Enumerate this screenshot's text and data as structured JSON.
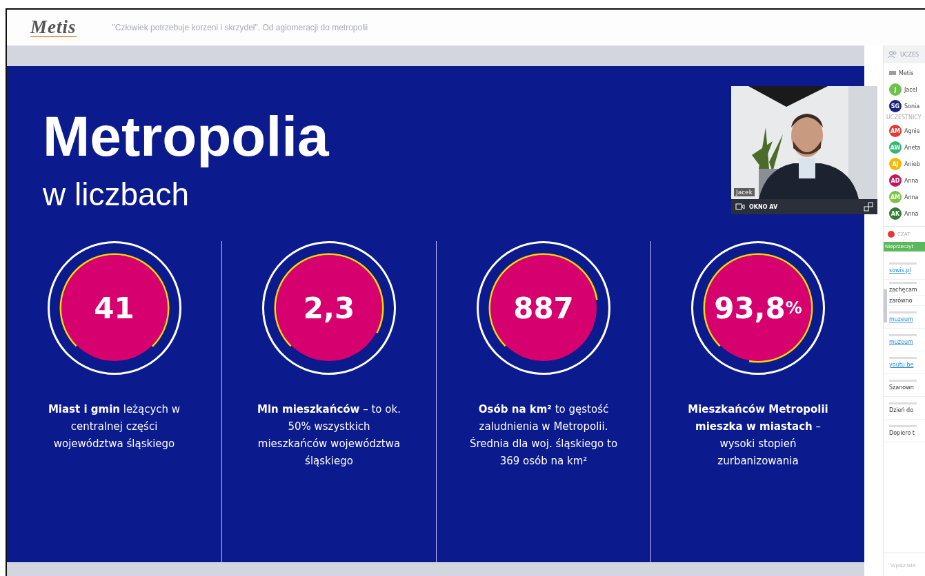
{
  "header": {
    "logo": "Metis",
    "title": "\"Człowiek potrzebuje korzeni i skrzydeł\". Od aglomeracji do metropolii"
  },
  "slide": {
    "title": "Metropolia",
    "subtitle": "w liczbach",
    "stats": [
      {
        "value": "41",
        "level": 0.75,
        "description": "**Miast i gmin** leżących w centralnej części województwa śląskiego"
      },
      {
        "value": "2,3",
        "level": 0.7,
        "description": "**Mln mieszkańców** – to ok. 50% wszystkich mieszkańców województwa śląskiego"
      },
      {
        "value": "887",
        "level": 0.6,
        "description": "**Osób na km²** to gęstość zaludnienia w Metropolii. Średnia dla woj. śląskiego to 369 osób na km²"
      },
      {
        "value": "93,8",
        "unit": "%",
        "level": 0.9,
        "description": "**Mieszkańców Metropolii mieszka w miastach** – wysoki stopień zurbanizowania"
      }
    ]
  },
  "video": {
    "kind": "picture",
    "speaker": "Jacek",
    "bar_label": "OKNO AV"
  },
  "sidebar": {
    "participants_header": "UCZES",
    "hosts": [
      {
        "kind": "tag",
        "name": "Metis",
        "color": "#9e9e9e"
      },
      {
        "kind": "avatar",
        "initials": "J",
        "name": "Jacel",
        "color": "#6cc24a"
      },
      {
        "kind": "avatar",
        "initials": "SG",
        "name": "Sonia",
        "color": "#1a237e"
      }
    ],
    "group_label": "UCZESTNICY",
    "participants": [
      {
        "initials": "AM",
        "name": "Agnie",
        "color": "#e53935"
      },
      {
        "initials": "AW",
        "name": "Aneta",
        "color": "#2eb872"
      },
      {
        "initials": "AJ",
        "name": "Anieb",
        "color": "#f5b800"
      },
      {
        "initials": "AD",
        "name": "Anna",
        "color": "#c2185b"
      },
      {
        "initials": "AM",
        "name": "Anna",
        "color": "#7cc444"
      },
      {
        "initials": "AK",
        "name": "Anna",
        "color": "#2e7d32"
      }
    ],
    "chat_label": "CZAT",
    "chat_badge": "Nieprzeczyt",
    "messages": [
      {
        "kind": "link",
        "text": "sowis.pl"
      },
      {
        "kind": "text",
        "text": "zachęcam"
      },
      {
        "kind": "text",
        "text": "zarówno"
      },
      {
        "kind": "link",
        "text": "muzeum"
      },
      {
        "kind": "link",
        "text": "muzeum"
      },
      {
        "kind": "link",
        "text": "youtu.be"
      },
      {
        "kind": "text",
        "text": "Szanown"
      },
      {
        "kind": "text",
        "text": "Dzień do"
      },
      {
        "kind": "text",
        "text": "Dopiero t"
      }
    ],
    "input_placeholder": "Wpisz wia"
  }
}
